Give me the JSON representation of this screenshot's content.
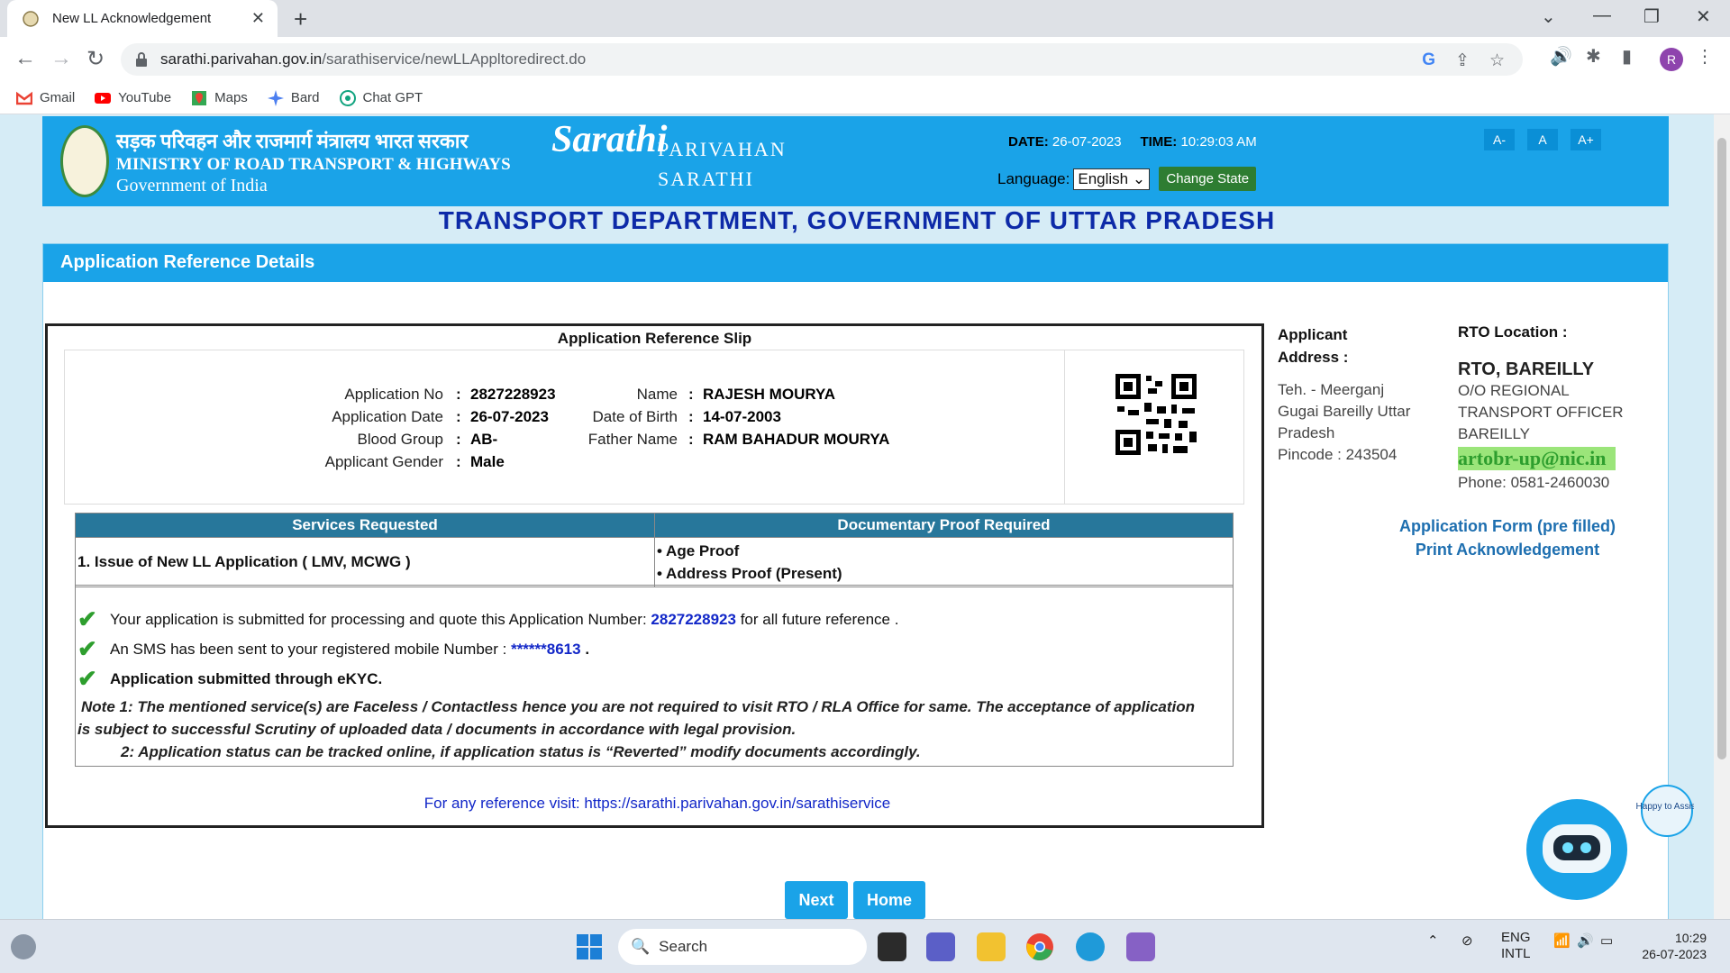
{
  "browser": {
    "tab_title": "New LL Acknowledgement",
    "url_host": "sarathi.parivahan.gov.in",
    "url_path": "/sarathiservice/newLLAppltoredirect.do",
    "avatar_letter": "R",
    "bookmarks": [
      "Gmail",
      "YouTube",
      "Maps",
      "Bard",
      "Chat GPT"
    ]
  },
  "header": {
    "ministry_hindi": "सड़क परिवहन और राजमार्ग मंत्रालय भारत सरकार",
    "ministry_english": "MINISTRY OF ROAD TRANSPORT & HIGHWAYS",
    "government": "Government of India",
    "logo_text": "Sarathi",
    "brand_line1": "PARIVAHAN",
    "brand_line2": "SARATHI",
    "date_label": "DATE:",
    "date_value": "26-07-2023",
    "time_label": "TIME:",
    "time_value": "10:29:03 AM",
    "language_label": "Language:",
    "language_value": "English",
    "change_state": "Change State",
    "font_small": "A-",
    "font_normal": "A",
    "font_large": "A+"
  },
  "dept_title": "TRANSPORT DEPARTMENT, GOVERNMENT OF UTTAR PRADESH",
  "panel_title": "Application Reference Details",
  "slip": {
    "title": "Application Reference Slip",
    "app_no_label": "Application No",
    "app_no": "2827228923",
    "app_date_label": "Application Date",
    "app_date": "26-07-2023",
    "blood_label": "Blood Group",
    "blood": "AB-",
    "gender_label": "Applicant Gender",
    "gender": "Male",
    "name_label": "Name",
    "name": "RAJESH MOURYA",
    "dob_label": "Date of Birth",
    "dob": "14-07-2003",
    "father_label": "Father Name",
    "father": "RAM BAHADUR MOURYA"
  },
  "services": {
    "col1": "Services Requested",
    "col2": "Documentary Proof Required",
    "service": "1. Issue of New LL Application ( LMV, MCWG )",
    "proof1": "• Age Proof",
    "proof2": "• Address Proof (Present)"
  },
  "messages": {
    "m1_pre": "Your application is submitted for processing and quote this Application Number:",
    "m1_num": "2827228923",
    "m1_post": "for all future reference .",
    "m2_pre": "An SMS has been sent to your registered mobile Number :",
    "m2_num": "******8613",
    "m2_post": ".",
    "m3": "Application submitted through eKYC.",
    "note1a": "Note 1:  The mentioned service(s) are Faceless / Contactless hence you are not required to visit RTO / RLA Office for same. The acceptance of application",
    "note1b": "is subject to successful Scrutiny of uploaded data / documents in accordance with legal provision.",
    "note2": "2:  Application status can be tracked online, if application status is “Reverted” modify documents accordingly."
  },
  "ref_visit": "For any reference visit: https://sarathi.parivahan.gov.in/sarathiservice",
  "applicant": {
    "h1": "Applicant",
    "h2": "Address :",
    "a1": "Teh. - Meerganj",
    "a2": "Gugai Bareilly Uttar",
    "a3": "Pradesh",
    "a4": "Pincode : 243504"
  },
  "rto": {
    "heading": "RTO Location :",
    "office": "RTO, BAREILLY",
    "sub1": "O/O REGIONAL",
    "sub2": "TRANSPORT OFFICER",
    "sub3": "BAREILLY",
    "email": "artobr-up@nic.in",
    "phone": "Phone:  0581-2460030"
  },
  "links": {
    "form": "Application Form (pre filled)",
    "ack": "Print Acknowledgement"
  },
  "buttons": {
    "next": "Next",
    "home": "Home"
  },
  "bot_text": "Happy to Assist",
  "taskbar": {
    "search": "Search",
    "lang1": "ENG",
    "lang2": "INTL",
    "time": "10:29",
    "date": "26-07-2023"
  }
}
